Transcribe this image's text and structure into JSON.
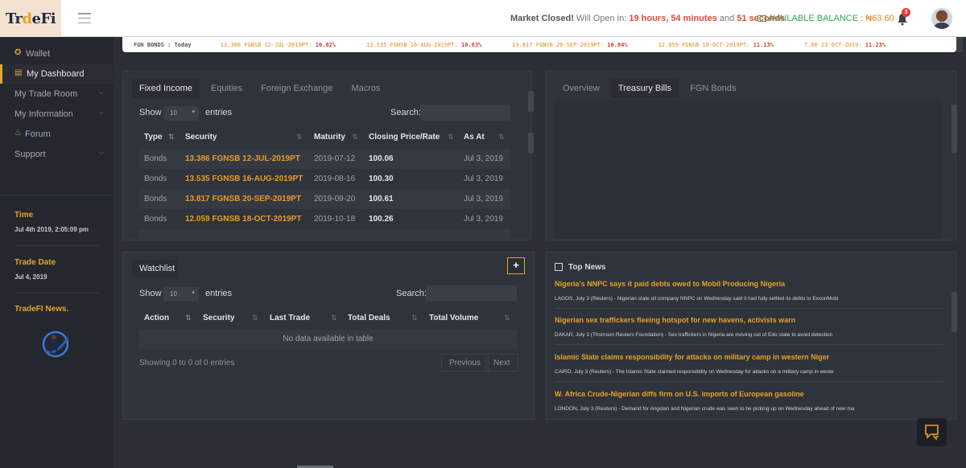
{
  "header": {
    "logo_a": "Tr",
    "logo_b": "d",
    "logo_c": "eFi",
    "market_prefix": "Market Closed!",
    "market_mid": "Will Open in:",
    "hours": "19 hours,",
    "minutes": "54 minutes",
    "and": "and",
    "seconds": "51 seconds",
    "balance_label": "AVAILABLE BALANCE :",
    "balance_value": "₦63.60",
    "notification_count": "3"
  },
  "ticker": {
    "head": "FGN BONDS : Today",
    "items": [
      {
        "name": "13.386 FGNSB 12-JUL-2019PT:",
        "rate": "10.82%"
      },
      {
        "name": "13.535 FGNSB 16-AUG-2019PT:",
        "rate": "10.83%"
      },
      {
        "name": "13.817 FGNSB 20-SEP-2019PT:",
        "rate": "10.84%"
      },
      {
        "name": "12.059 FGNSB 18-OCT-2019PT:",
        "rate": "11.13%"
      },
      {
        "name": "7.00 23-OCT-2019:",
        "rate": "11.23%"
      }
    ]
  },
  "sidebar": {
    "items": [
      {
        "label": "Wallet"
      },
      {
        "label": "My Dashboard"
      },
      {
        "label": "My Trade Room"
      },
      {
        "label": "My Information"
      },
      {
        "label": "Forum"
      },
      {
        "label": "Support"
      }
    ],
    "time_label": "Time",
    "time_value": "Jul 4th 2019, 2:05:09 pm",
    "trade_date_label": "Trade Date",
    "trade_date_value": "Jul 4, 2019",
    "news_label": "TradeFI News."
  },
  "market_panel": {
    "tabs": [
      "Fixed Income",
      "Equities",
      "Foreign Exchange",
      "Macros"
    ],
    "show": "Show",
    "entries": "entries",
    "page_size": "10",
    "search": "Search:",
    "columns": [
      "Type",
      "Security",
      "Maturity",
      "Closing Price/Rate",
      "As At"
    ],
    "rows": [
      {
        "type": "Bonds",
        "security": "13.386 FGNSB 12-JUL-2019PT",
        "maturity": "2019-07-12",
        "price": "100.06",
        "as_at": "Jul 3, 2019"
      },
      {
        "type": "Bonds",
        "security": "13.535 FGNSB 16-AUG-2019PT",
        "maturity": "2019-08-16",
        "price": "100.30",
        "as_at": "Jul 3, 2019"
      },
      {
        "type": "Bonds",
        "security": "13.817 FGNSB 20-SEP-2019PT",
        "maturity": "2019-09-20",
        "price": "100.61",
        "as_at": "Jul 3, 2019"
      },
      {
        "type": "Bonds",
        "security": "12.059 FGNSB 18-OCT-2019PT",
        "maturity": "2019-10-18",
        "price": "100.26",
        "as_at": "Jul 3, 2019"
      }
    ]
  },
  "right_panel": {
    "tabs": [
      "Overview",
      "Treasury Bills",
      "FGN Bonds"
    ]
  },
  "watchlist": {
    "title": "Watchlist",
    "add": "+",
    "show": "Show",
    "entries": "entries",
    "page_size": "10",
    "search": "Search:",
    "columns": [
      "Action",
      "Security",
      "Last Trade",
      "Total Deals",
      "Total Volume"
    ],
    "empty": "No data available in table",
    "info": "Showing 0 to 0 of 0 entries",
    "previous": "Previous",
    "next": "Next"
  },
  "news": {
    "title": "Top News",
    "items": [
      {
        "headline": "Nigeria's NNPC says it paid debts owed to Mobil Producing Nigeria",
        "body": "LAGOS, July 3 (Reuters) - Nigerian state oil company NNPC on Wednesday said it had fully settled its debts to ExxonMobi"
      },
      {
        "headline": "Nigerian sex traffickers fleeing hotspot for new havens, activists warn",
        "body": "DAKAR, July 3 (Thomson Reuters Foundation) - Sex traffickers in Nigeria are moving out of Edo state to avoid detection"
      },
      {
        "headline": "Islamic State claims responsibility for attacks on military camp in western Niger",
        "body": "CAIRO, July 3 (Reuters) - The Islamic State claimed responsibility on Wednesday for attacks on a military camp in weste"
      },
      {
        "headline": "W. Africa Crude-Nigerian diffs firm on U.S. imports of European gasoline",
        "body": "LONDON, July 3 (Reuters) - Demand for Angolan and Nigerian crude was seen to be picking up on Wednesday ahead of new ma"
      }
    ]
  },
  "colors": {
    "accent": "#e6a32a",
    "balance": "#2fa84f",
    "alert": "#e0493e"
  }
}
